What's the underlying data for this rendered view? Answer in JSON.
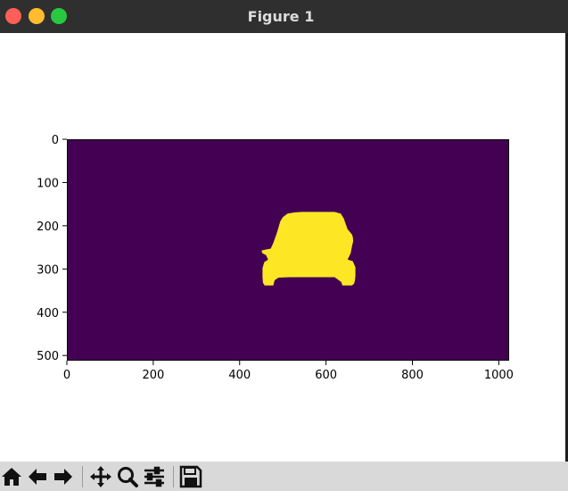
{
  "window": {
    "title": "Figure 1"
  },
  "toolbar": {
    "buttons": [
      {
        "name": "home-button",
        "icon": "home-icon"
      },
      {
        "name": "back-button",
        "icon": "arrow-left-icon"
      },
      {
        "name": "forward-button",
        "icon": "arrow-right-icon"
      },
      {
        "name": "pan-button",
        "icon": "move-icon"
      },
      {
        "name": "zoom-button",
        "icon": "magnifier-icon"
      },
      {
        "name": "configure-subplots-button",
        "icon": "sliders-icon"
      },
      {
        "name": "save-button",
        "icon": "floppy-disk-icon"
      }
    ]
  },
  "colors": {
    "background": "#440154",
    "mask": "#fde725",
    "titlebar": "#2f2f2f"
  },
  "chart_data": {
    "type": "heatmap",
    "description_of_values": "binary segmentation mask (0 background, 1 car)",
    "image_width": 1024,
    "image_height": 512,
    "xlim": [
      0,
      1024
    ],
    "ylim": [
      512,
      0
    ],
    "xticks": [
      "0",
      "200",
      "400",
      "600",
      "800",
      "1000"
    ],
    "yticks": [
      "0",
      "100",
      "200",
      "300",
      "400",
      "500"
    ],
    "x_tick_values": [
      0,
      200,
      400,
      600,
      800,
      1000
    ],
    "y_tick_values": [
      0,
      100,
      200,
      300,
      400,
      500
    ],
    "mask_outline": [
      [
        545,
        168
      ],
      [
        620,
        168
      ],
      [
        634,
        172
      ],
      [
        641,
        183
      ],
      [
        650,
        208
      ],
      [
        660,
        220
      ],
      [
        662,
        226
      ],
      [
        663,
        236
      ],
      [
        660,
        248
      ],
      [
        657,
        264
      ],
      [
        650,
        278
      ],
      [
        662,
        282
      ],
      [
        668,
        296
      ],
      [
        668,
        315
      ],
      [
        667,
        326
      ],
      [
        665,
        334
      ],
      [
        660,
        338
      ],
      [
        638,
        338
      ],
      [
        635,
        330
      ],
      [
        620,
        319
      ],
      [
        516,
        319
      ],
      [
        490,
        320
      ],
      [
        481,
        326
      ],
      [
        478,
        338
      ],
      [
        458,
        338
      ],
      [
        454,
        332
      ],
      [
        453,
        318
      ],
      [
        453,
        298
      ],
      [
        457,
        284
      ],
      [
        466,
        278
      ],
      [
        461,
        268
      ],
      [
        452,
        263
      ],
      [
        451,
        257
      ],
      [
        461,
        255
      ],
      [
        472,
        253
      ],
      [
        478,
        240
      ],
      [
        487,
        214
      ],
      [
        494,
        190
      ],
      [
        500,
        180
      ],
      [
        511,
        172
      ],
      [
        528,
        169
      ]
    ]
  }
}
